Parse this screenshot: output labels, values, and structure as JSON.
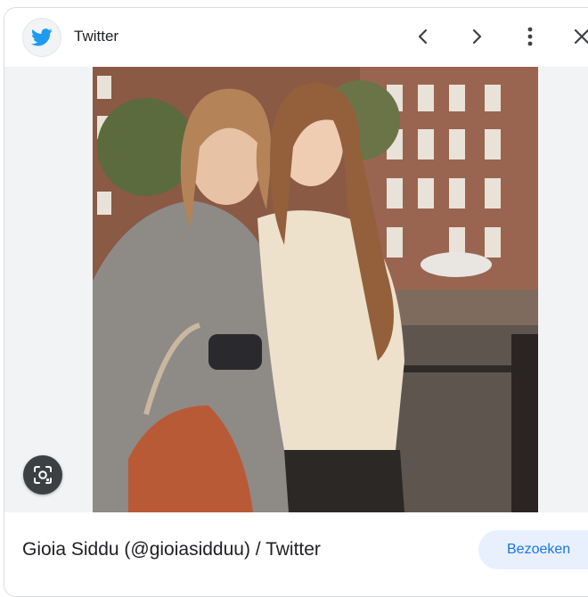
{
  "header": {
    "source_name": "Twitter",
    "source_icon": "twitter-bird-icon",
    "brand_color": "#1d9bf0",
    "prev_icon": "chevron-left-icon",
    "next_icon": "chevron-right-icon",
    "more_icon": "more-vert-icon",
    "close_icon": "close-icon"
  },
  "media": {
    "image_description": "photo",
    "lens_icon": "google-lens-icon"
  },
  "footer": {
    "title": "Gioia Siddu (@gioiasidduu) / Twitter",
    "visit_label": "Bezoeken",
    "accent_color": "#1a73e8"
  }
}
